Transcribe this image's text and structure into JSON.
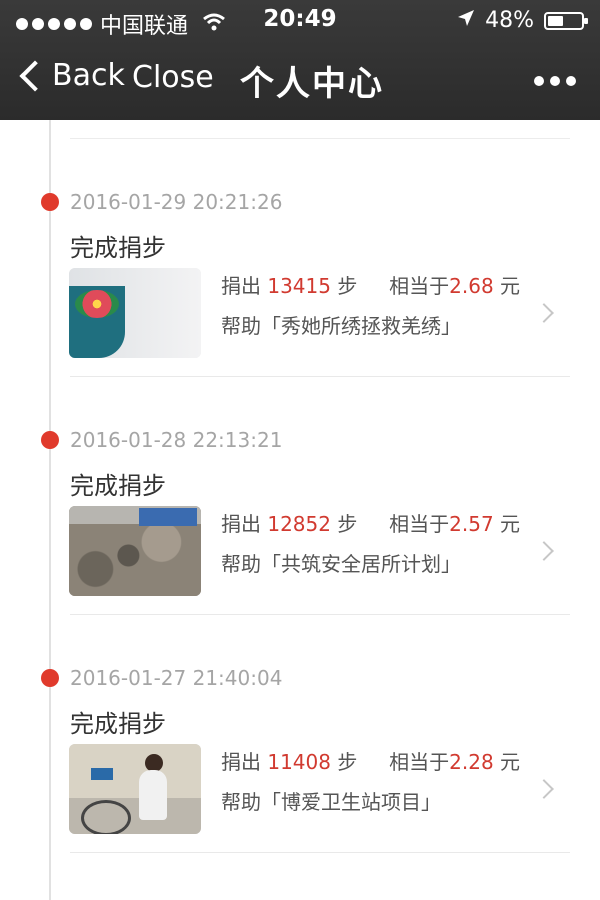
{
  "status_bar": {
    "carrier": "中国联通",
    "time": "20:49",
    "battery_text": "48%",
    "battery_level": 0.48,
    "icons": [
      "signal-dots-icon",
      "wifi-icon",
      "location-arrow-icon",
      "battery-icon"
    ]
  },
  "nav": {
    "back_label": "Back",
    "close_label": "Close",
    "title": "个人中心",
    "more_icon": "more-dots-icon"
  },
  "entries": [
    {
      "date": "2016-01-29 20:21:26",
      "action": "完成捐步",
      "donate_prefix": "捐出",
      "steps": "13415",
      "steps_unit": "步",
      "equiv_prefix": "相当于",
      "amount": "2.68",
      "amount_unit": "元",
      "help_text": "帮助「秀她所绣拯救羌绣」"
    },
    {
      "date": "2016-01-28 22:13:21",
      "action": "完成捐步",
      "donate_prefix": "捐出",
      "steps": "12852",
      "steps_unit": "步",
      "equiv_prefix": "相当于",
      "amount": "2.57",
      "amount_unit": "元",
      "help_text": "帮助「共筑安全居所计划」"
    },
    {
      "date": "2016-01-27 21:40:04",
      "action": "完成捐步",
      "donate_prefix": "捐出",
      "steps": "11408",
      "steps_unit": "步",
      "equiv_prefix": "相当于",
      "amount": "2.28",
      "amount_unit": "元",
      "help_text": "帮助「博爱卫生站项目」"
    }
  ],
  "colors": {
    "accent_red": "#e03a2c",
    "topbar": "#2f2f2f"
  }
}
